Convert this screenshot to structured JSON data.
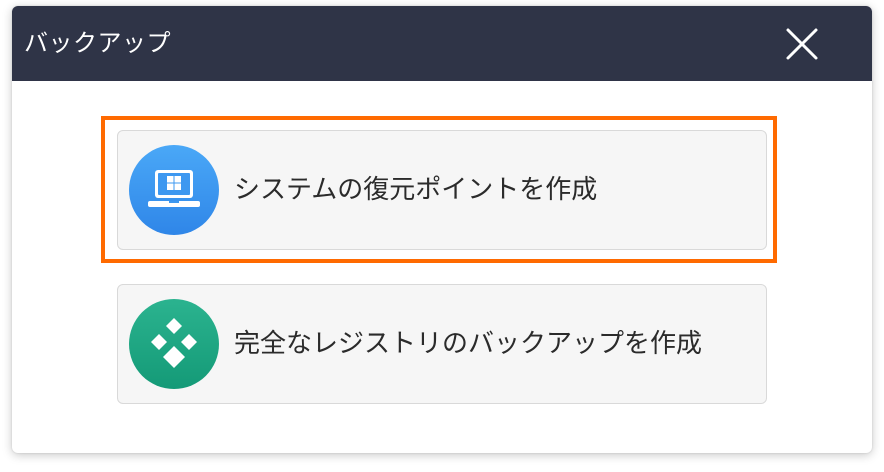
{
  "dialog": {
    "title": "バックアップ",
    "close_icon": "close-icon"
  },
  "options": [
    {
      "label": "システムの復元ポイントを作成",
      "icon": "laptop-windows-icon",
      "icon_color_top": "#4aa8f7",
      "icon_color_bottom": "#2f86e8",
      "highlighted": true
    },
    {
      "label": "完全なレジストリのバックアップを作成",
      "icon": "registry-diamond-icon",
      "icon_color_top": "#2bb38f",
      "icon_color_bottom": "#149a77",
      "highlighted": false
    }
  ],
  "colors": {
    "titlebar": "#2f3447",
    "highlight": "#ff6a00",
    "option_bg": "#f6f6f6"
  }
}
